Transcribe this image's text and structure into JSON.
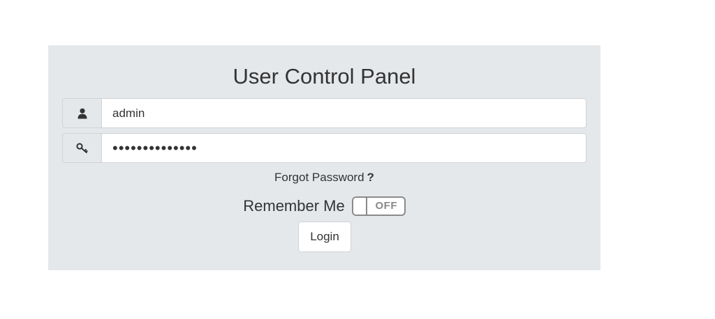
{
  "panel": {
    "title": "User Control Panel",
    "background_color": "#e5e8eb"
  },
  "username": {
    "icon": "user-icon",
    "value": "admin"
  },
  "password": {
    "icon": "key-icon",
    "value": "••••••••••••••"
  },
  "forgot": {
    "label": "Forgot Password",
    "icon_glyph": "?"
  },
  "remember": {
    "label": "Remember Me",
    "toggle_state": "OFF",
    "checked": false
  },
  "login": {
    "label": "Login"
  }
}
